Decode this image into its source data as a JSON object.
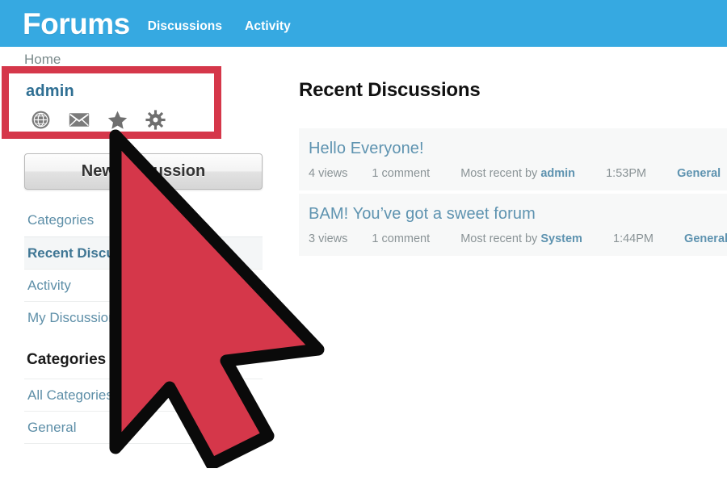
{
  "banner": {
    "title": "Forums",
    "nav": [
      {
        "label": "Discussions"
      },
      {
        "label": "Activity"
      }
    ]
  },
  "breadcrumb": {
    "label": "Home"
  },
  "sidebar": {
    "profile": {
      "name": "admin",
      "icons": [
        {
          "name": "globe-icon"
        },
        {
          "name": "envelope-icon"
        },
        {
          "name": "star-icon"
        },
        {
          "name": "gear-icon"
        }
      ]
    },
    "new_discussion_label": "New Discussion",
    "nav_items": [
      {
        "label": "Categories",
        "active": false
      },
      {
        "label": "Recent Discussions",
        "active": true
      },
      {
        "label": "Activity",
        "active": false
      },
      {
        "label": "My Discussions",
        "active": false
      }
    ],
    "categories_heading": "Categories",
    "categories": [
      {
        "label": "All Categories"
      },
      {
        "label": "General"
      }
    ]
  },
  "main": {
    "title": "Recent Discussions",
    "discussions": [
      {
        "title": "Hello Everyone!",
        "views": "4 views",
        "comments": "1 comment",
        "most_recent_prefix": "Most recent by",
        "most_recent_user": "admin",
        "time": "1:53PM",
        "category": "General"
      },
      {
        "title": "BAM! You’ve got a sweet forum",
        "views": "3 views",
        "comments": "1 comment",
        "most_recent_prefix": "Most recent by",
        "most_recent_user": "System",
        "time": "1:44PM",
        "category": "General"
      }
    ]
  },
  "annotations": {
    "highlight_box": {
      "name": "profile-highlight-box",
      "color": "#d5374a"
    },
    "cursor": {
      "name": "cursor-pointer",
      "fill": "#d5374a",
      "stroke": "#000000"
    }
  },
  "colors": {
    "banner_blue": "#36a9e1",
    "link_blue": "#5e93b0",
    "annotation_red": "#d5374a",
    "row_gray": "#f7f8f8"
  }
}
